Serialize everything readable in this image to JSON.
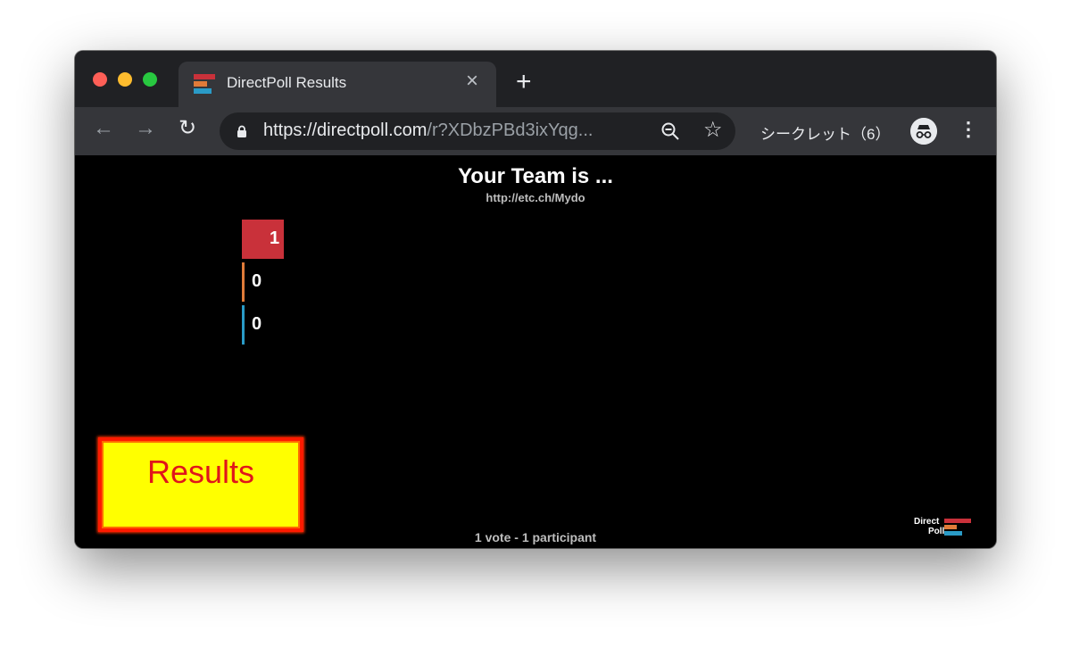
{
  "browser": {
    "tab_title": "DirectPoll Results",
    "tab_close": "×",
    "new_tab": "+",
    "url_host": "https://directpoll.com",
    "url_rest": "/r?XDbzPBd3ixYqg...",
    "incognito_label": "シークレット（6）",
    "nav": {
      "back": "←",
      "forward": "→",
      "reload": "↻",
      "bookmark": "☆",
      "menu": "⋮"
    },
    "icons": [
      "lock-icon",
      "zoom-out-icon",
      "star-icon",
      "incognito-icon",
      "kebab-menu-icon"
    ]
  },
  "poll": {
    "title": "Your Team is ...",
    "link": "http://etc.ch/Mydo",
    "footer": "1 vote - 1 participant"
  },
  "chart_data": {
    "type": "bar",
    "orientation": "horizontal",
    "categories": [
      "",
      "",
      ""
    ],
    "values": [
      1,
      0,
      0
    ],
    "colors": [
      "#c9313a",
      "#e07b39",
      "#2a9bc7"
    ],
    "value_labels": [
      "1",
      "0",
      "0"
    ],
    "xlim": [
      0,
      1
    ]
  },
  "overlay": {
    "results_label": "Results",
    "box_fill": "#ffff00",
    "text_color": "#e0151b"
  },
  "brand": {
    "line1": "Direct",
    "line2": "Poll",
    "colors": [
      "#c9313a",
      "#e07b39",
      "#2a9bc7"
    ]
  }
}
